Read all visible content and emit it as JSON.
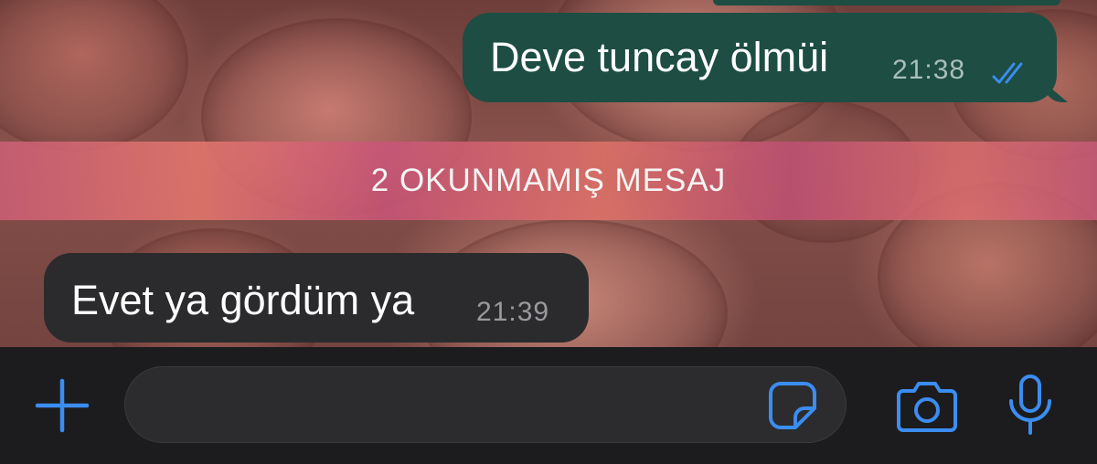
{
  "chat": {
    "messages": [
      {
        "direction": "outgoing",
        "text": "Deve tuncay ölmüi",
        "time": "21:38",
        "status": "read"
      },
      {
        "direction": "incoming",
        "text": "Evet ya gördüm ya",
        "time": "21:39"
      }
    ],
    "unread_divider": "2 OKUNMAMIŞ MESAJ"
  },
  "composer": {
    "icons": [
      "plus-icon",
      "sticker-icon",
      "camera-icon",
      "microphone-icon"
    ]
  },
  "colors": {
    "accent": "#3b8df0",
    "outgoing_bubble": "#1d4d43",
    "incoming_bubble": "#2b2b2d",
    "input_bar": "#1c1c1e"
  }
}
